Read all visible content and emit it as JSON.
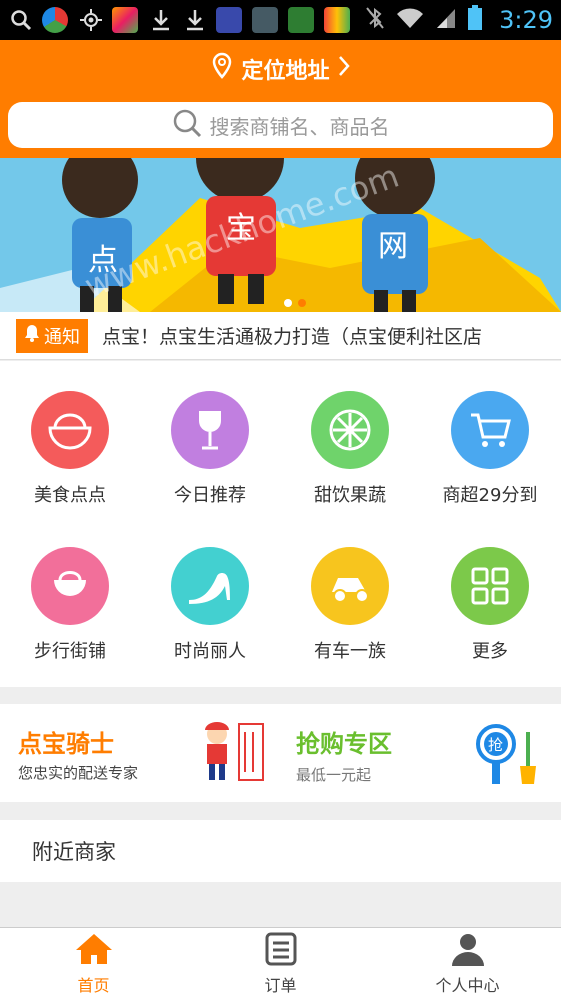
{
  "status_bar": {
    "time": "3:29"
  },
  "header": {
    "location_label": "定位地址",
    "search_placeholder": "搜索商铺名、商品名"
  },
  "banner": {
    "chars": [
      "点",
      "宝",
      "网"
    ],
    "watermark": "www.hackhome.com"
  },
  "notice": {
    "tag": "通知",
    "text": "点宝！点宝生活通极力打造（点宝便利社区店"
  },
  "categories": [
    {
      "label": "美食点点",
      "color": "#f45b5b",
      "icon": "bowl-icon"
    },
    {
      "label": "今日推荐",
      "color": "#c17fe0",
      "icon": "wine-glass-icon"
    },
    {
      "label": "甜饮果蔬",
      "color": "#6fd36b",
      "icon": "citrus-slice-icon"
    },
    {
      "label": "商超29分到",
      "color": "#4aa8f0",
      "icon": "shopping-cart-icon"
    },
    {
      "label": "步行街铺",
      "color": "#f26f9a",
      "icon": "bag-icon"
    },
    {
      "label": "时尚丽人",
      "color": "#43d0d0",
      "icon": "high-heel-icon"
    },
    {
      "label": "有车一族",
      "color": "#f7c51e",
      "icon": "car-icon"
    },
    {
      "label": "更多",
      "color": "#7cc94a",
      "icon": "more-grid-icon"
    }
  ],
  "promo": {
    "knight_title": "点宝骑士",
    "knight_subtitle": "您忠实的配送专家",
    "deal_title": "抢购专区",
    "deal_subtitle": "最低一元起",
    "deal_badge": "抢"
  },
  "nearby": {
    "title": "附近商家"
  },
  "tabs": [
    {
      "label": "首页",
      "icon": "home-icon"
    },
    {
      "label": "订单",
      "icon": "order-list-icon"
    },
    {
      "label": "个人中心",
      "icon": "person-icon"
    }
  ],
  "colors": {
    "accent": "#ff7d00"
  }
}
